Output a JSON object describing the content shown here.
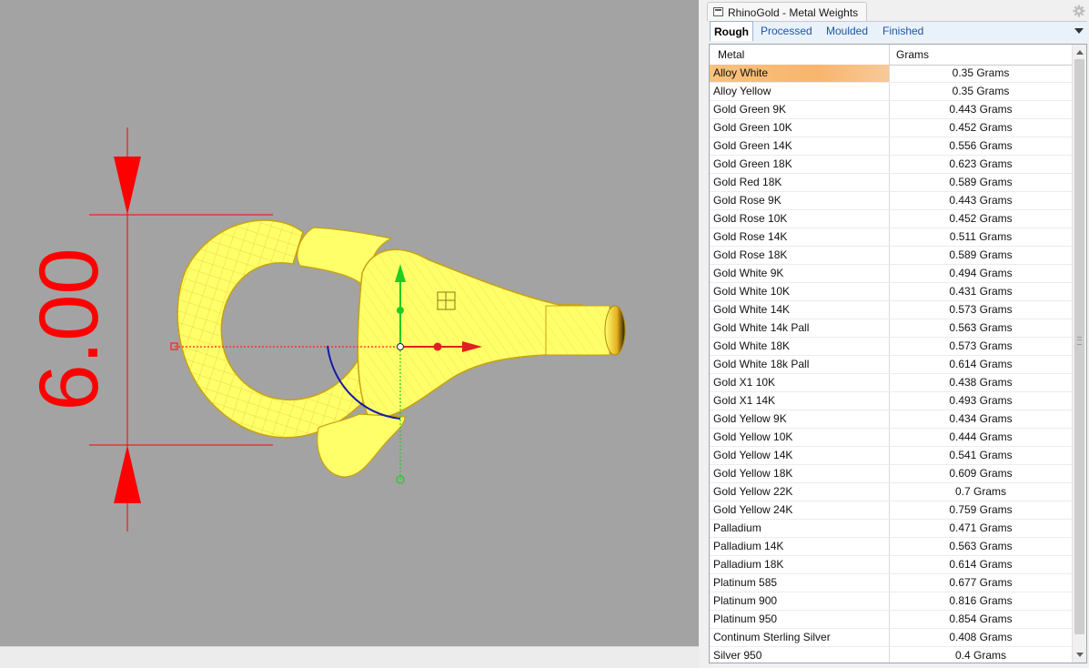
{
  "panel": {
    "title": "RhinoGold - Metal Weights",
    "tabs": [
      {
        "label": "Rough",
        "active": true
      },
      {
        "label": "Processed",
        "active": false
      },
      {
        "label": "Moulded",
        "active": false
      },
      {
        "label": "Finished",
        "active": false
      }
    ]
  },
  "table": {
    "headers": {
      "metal": "Metal",
      "grams": "Grams"
    },
    "selected_index": 0,
    "rows": [
      {
        "metal": "Alloy White",
        "grams": "0.35 Grams"
      },
      {
        "metal": "Alloy Yellow",
        "grams": "0.35 Grams"
      },
      {
        "metal": "Gold Green 9K",
        "grams": "0.443 Grams"
      },
      {
        "metal": "Gold Green 10K",
        "grams": "0.452 Grams"
      },
      {
        "metal": "Gold Green 14K",
        "grams": "0.556 Grams"
      },
      {
        "metal": "Gold Green 18K",
        "grams": "0.623 Grams"
      },
      {
        "metal": "Gold Red 18K",
        "grams": "0.589 Grams"
      },
      {
        "metal": "Gold Rose 9K",
        "grams": "0.443 Grams"
      },
      {
        "metal": "Gold Rose 10K",
        "grams": "0.452 Grams"
      },
      {
        "metal": "Gold Rose 14K",
        "grams": "0.511 Grams"
      },
      {
        "metal": "Gold Rose 18K",
        "grams": "0.589 Grams"
      },
      {
        "metal": "Gold White 9K",
        "grams": "0.494 Grams"
      },
      {
        "metal": "Gold White 10K",
        "grams": "0.431 Grams"
      },
      {
        "metal": "Gold White 14K",
        "grams": "0.573 Grams"
      },
      {
        "metal": "Gold White 14k Pall",
        "grams": "0.563 Grams"
      },
      {
        "metal": "Gold White 18K",
        "grams": "0.573 Grams"
      },
      {
        "metal": "Gold White 18k Pall",
        "grams": "0.614 Grams"
      },
      {
        "metal": "Gold X1 10K",
        "grams": "0.438 Grams"
      },
      {
        "metal": "Gold X1 14K",
        "grams": "0.493 Grams"
      },
      {
        "metal": "Gold Yellow 9K",
        "grams": "0.434 Grams"
      },
      {
        "metal": "Gold Yellow 10K",
        "grams": "0.444 Grams"
      },
      {
        "metal": "Gold Yellow 14K",
        "grams": "0.541 Grams"
      },
      {
        "metal": "Gold Yellow 18K",
        "grams": "0.609 Grams"
      },
      {
        "metal": "Gold Yellow 22K",
        "grams": "0.7 Grams"
      },
      {
        "metal": "Gold Yellow 24K",
        "grams": "0.759 Grams"
      },
      {
        "metal": "Palladium",
        "grams": "0.471 Grams"
      },
      {
        "metal": "Palladium 14K",
        "grams": "0.563 Grams"
      },
      {
        "metal": "Palladium 18K",
        "grams": "0.614 Grams"
      },
      {
        "metal": "Platinum 585",
        "grams": "0.677 Grams"
      },
      {
        "metal": "Platinum 900",
        "grams": "0.816 Grams"
      },
      {
        "metal": "Platinum 950",
        "grams": "0.854 Grams"
      },
      {
        "metal": "Continum Sterling Silver",
        "grams": "0.408 Grams"
      },
      {
        "metal": "Silver 950",
        "grams": "0.4 Grams"
      }
    ]
  },
  "viewport": {
    "dimension_text": "6.00",
    "colors": {
      "background": "#a3a3a3",
      "object": "#ffff6a",
      "wire": "#e0c21a",
      "dimension": "#ff0000",
      "gumball_x": "#e02020",
      "gumball_y": "#22cc22",
      "gumball_z": "#1a1aa8"
    },
    "icons": [
      "gear-icon",
      "panel-tab-icon",
      "dropdown-arrow-icon"
    ]
  }
}
